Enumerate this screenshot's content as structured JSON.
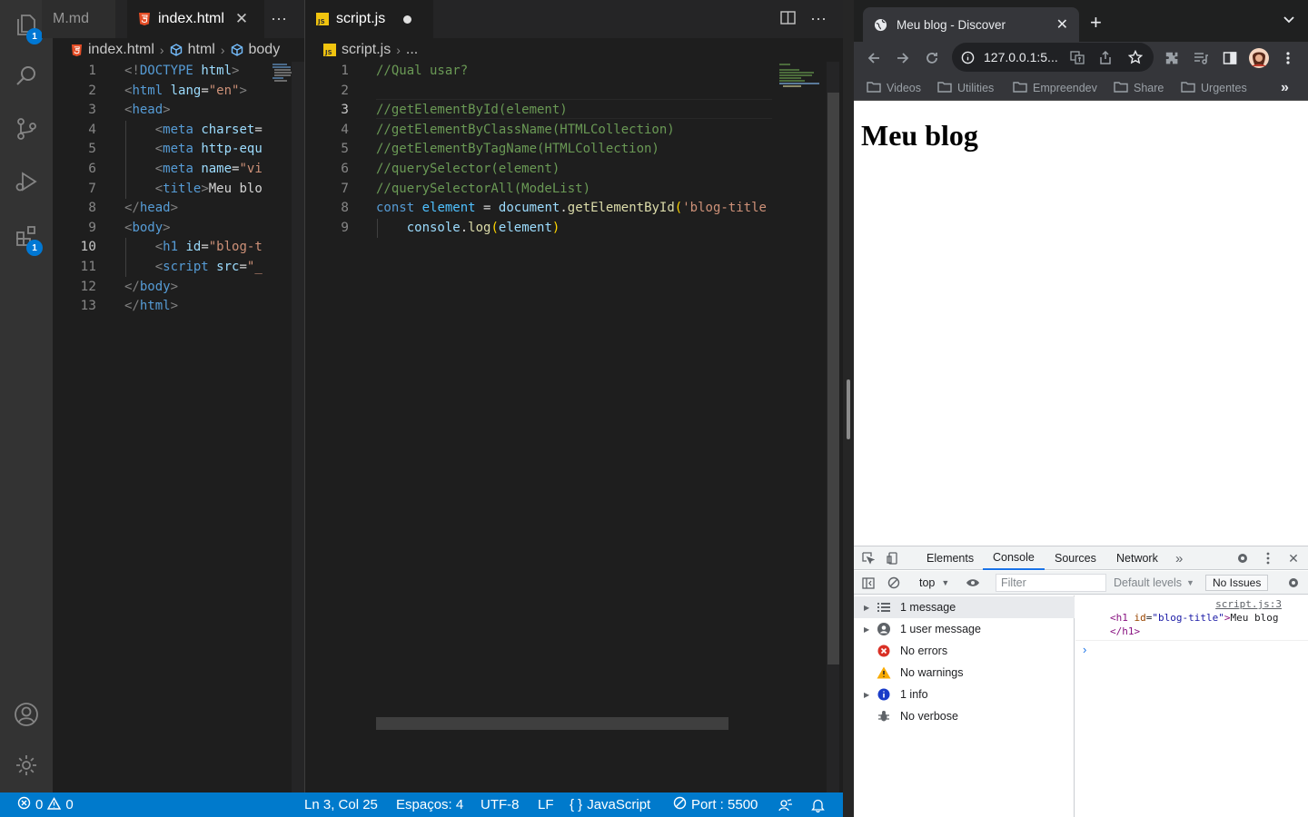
{
  "vscode": {
    "activity_badges": {
      "explorer": "1",
      "extensions": "1"
    },
    "left_group": {
      "tabs": [
        {
          "label": "M.md",
          "active": false
        },
        {
          "label": "index.html",
          "active": true
        }
      ],
      "breadcrumbs": [
        "index.html",
        "html",
        "body"
      ],
      "lines": [
        {
          "n": "1",
          "html": "<span class='t-br'>&lt;!</span><span class='t-tag'>DOCTYPE</span> <span class='t-attr'>html</span><span class='t-br'>&gt;</span>"
        },
        {
          "n": "2",
          "html": "<span class='t-br'>&lt;</span><span class='t-tag'>html</span> <span class='t-attr'>lang</span>=<span class='t-str'>\"en\"</span><span class='t-br'>&gt;</span>"
        },
        {
          "n": "3",
          "html": "<span class='t-br'>&lt;</span><span class='t-tag'>head</span><span class='t-br'>&gt;</span>"
        },
        {
          "n": "4",
          "html": "    <span class='t-br'>&lt;</span><span class='t-tag'>meta</span> <span class='t-attr'>charset</span>="
        },
        {
          "n": "5",
          "html": "    <span class='t-br'>&lt;</span><span class='t-tag'>meta</span> <span class='t-attr'>http-equ</span>"
        },
        {
          "n": "6",
          "html": "    <span class='t-br'>&lt;</span><span class='t-tag'>meta</span> <span class='t-attr'>name</span>=<span class='t-str'>\"vi</span>"
        },
        {
          "n": "7",
          "html": "    <span class='t-br'>&lt;</span><span class='t-tag'>title</span><span class='t-br'>&gt;</span><span class='t-txt'>Meu blo</span>"
        },
        {
          "n": "8",
          "html": "<span class='t-br'>&lt;/</span><span class='t-tag'>head</span><span class='t-br'>&gt;</span>"
        },
        {
          "n": "9",
          "html": "<span class='t-br'>&lt;</span><span class='t-tag'>body</span><span class='t-br'>&gt;</span>"
        },
        {
          "n": "10",
          "html": "    <span class='t-br'>&lt;</span><span class='t-tag'>h1</span> <span class='t-attr'>id</span>=<span class='t-str'>\"blog-t</span>"
        },
        {
          "n": "11",
          "html": "    <span class='t-br'>&lt;</span><span class='t-tag'>script</span> <span class='t-attr'>src</span>=<span class='t-str'>\"_</span>"
        },
        {
          "n": "12",
          "html": "<span class='t-br'>&lt;/</span><span class='t-tag'>body</span><span class='t-br'>&gt;</span>"
        },
        {
          "n": "13",
          "html": "<span class='t-br'>&lt;/</span><span class='t-tag'>html</span><span class='t-br'>&gt;</span>"
        }
      ],
      "current_line": "10"
    },
    "right_group": {
      "tabs": [
        {
          "label": "script.js",
          "active": true,
          "dirty": true
        }
      ],
      "breadcrumbs": [
        "script.js",
        "..."
      ],
      "lines": [
        {
          "n": "1",
          "html": "<span class='t-cmt'>//Qual usar?</span>"
        },
        {
          "n": "2",
          "html": ""
        },
        {
          "n": "3",
          "html": "<span class='t-cmt'>//getElementById(element)</span>"
        },
        {
          "n": "4",
          "html": "<span class='t-cmt'>//getElementByClassName(HTMLCollection)</span>"
        },
        {
          "n": "5",
          "html": "<span class='t-cmt'>//getElementByTagName(HTMLCollection)</span>"
        },
        {
          "n": "6",
          "html": "<span class='t-cmt'>//querySelector(element)</span>"
        },
        {
          "n": "7",
          "html": "<span class='t-cmt'>//querySelectorAll(ModeList)</span>"
        },
        {
          "n": "8",
          "html": "<span class='t-kw'>const</span> <span class='t-var'>element</span> = <span class='t-attr'>document</span>.<span class='t-fn'>getElementById</span><span class='t-par'>(</span><span class='t-str'>'blog-title</span>"
        },
        {
          "n": "9",
          "html": "    <span class='t-attr'>console</span>.<span class='t-fn'>log</span><span class='t-par'>(</span><span class='t-attr'>element</span><span class='t-par'>)</span>"
        }
      ],
      "current_line": "3"
    },
    "status": {
      "errors": "0",
      "warnings": "0",
      "position": "Ln 3, Col 25",
      "spaces": "Espaços: 4",
      "encoding": "UTF-8",
      "eol": "LF",
      "language": "JavaScript",
      "port": "Port : 5500"
    }
  },
  "chrome": {
    "tab_title": "Meu blog - Discover",
    "url": "127.0.0.1:5...",
    "bookmarks": [
      "Videos",
      "Utilities",
      "Empreendev",
      "Share",
      "Urgentes"
    ],
    "page_heading": "Meu blog",
    "devtools": {
      "tabs": [
        "Elements",
        "Console",
        "Sources",
        "Network"
      ],
      "active_tab": "Console",
      "context": "top",
      "filter_placeholder": "Filter",
      "levels": "Default levels",
      "issues": "No Issues",
      "sidebar": [
        {
          "label": "1 message",
          "icon": "list-icon",
          "expandable": true,
          "selected": true
        },
        {
          "label": "1 user message",
          "icon": "user-icon",
          "expandable": true,
          "selected": false
        },
        {
          "label": "No errors",
          "icon": "error-icon",
          "expandable": false,
          "selected": false
        },
        {
          "label": "No warnings",
          "icon": "warning-icon",
          "expandable": false,
          "selected": false
        },
        {
          "label": "1 info",
          "icon": "info-icon",
          "expandable": true,
          "selected": false
        },
        {
          "label": "No verbose",
          "icon": "bug-icon",
          "expandable": false,
          "selected": false
        }
      ],
      "log": {
        "source": "script.js:3",
        "tag": "h1",
        "attr_name": "id",
        "attr_value": "blog-title",
        "text": "Meu blog"
      }
    }
  },
  "colors": {
    "statusbar": "#007acc",
    "editor_bg": "#1e1e1e",
    "activity_bg": "#333333",
    "chrome_dark": "#35363a",
    "devtools_accent": "#1a73e8"
  }
}
